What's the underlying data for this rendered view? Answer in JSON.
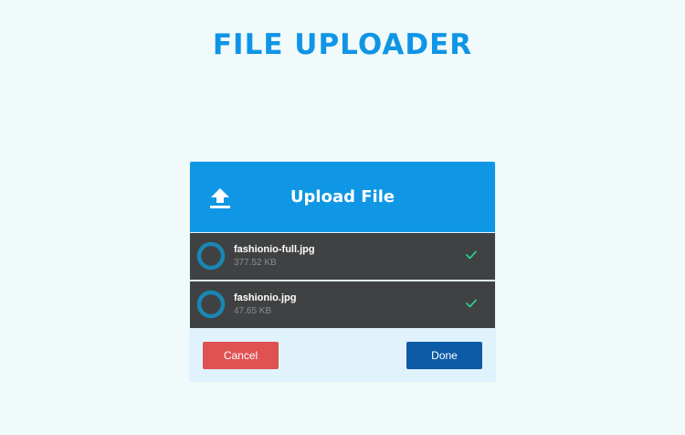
{
  "page": {
    "title": "FILE UPLOADER"
  },
  "uploader": {
    "header_title": "Upload File",
    "header_icon": "upload-icon",
    "files": [
      {
        "name": "fashionio-full.jpg",
        "size": "377.52 KB",
        "status_icon": "check-icon"
      },
      {
        "name": "fashionio.jpg",
        "size": "47.65 KB",
        "status_icon": "check-icon"
      }
    ],
    "cancel_label": "Cancel",
    "done_label": "Done"
  },
  "colors": {
    "background": "#f1fafa",
    "accent": "#0f97e6",
    "row_background": "#3f4142",
    "progress_ring": "#1a86b3",
    "success": "#2ecc8a",
    "cancel": "#e05252",
    "done": "#0d5ba6"
  }
}
